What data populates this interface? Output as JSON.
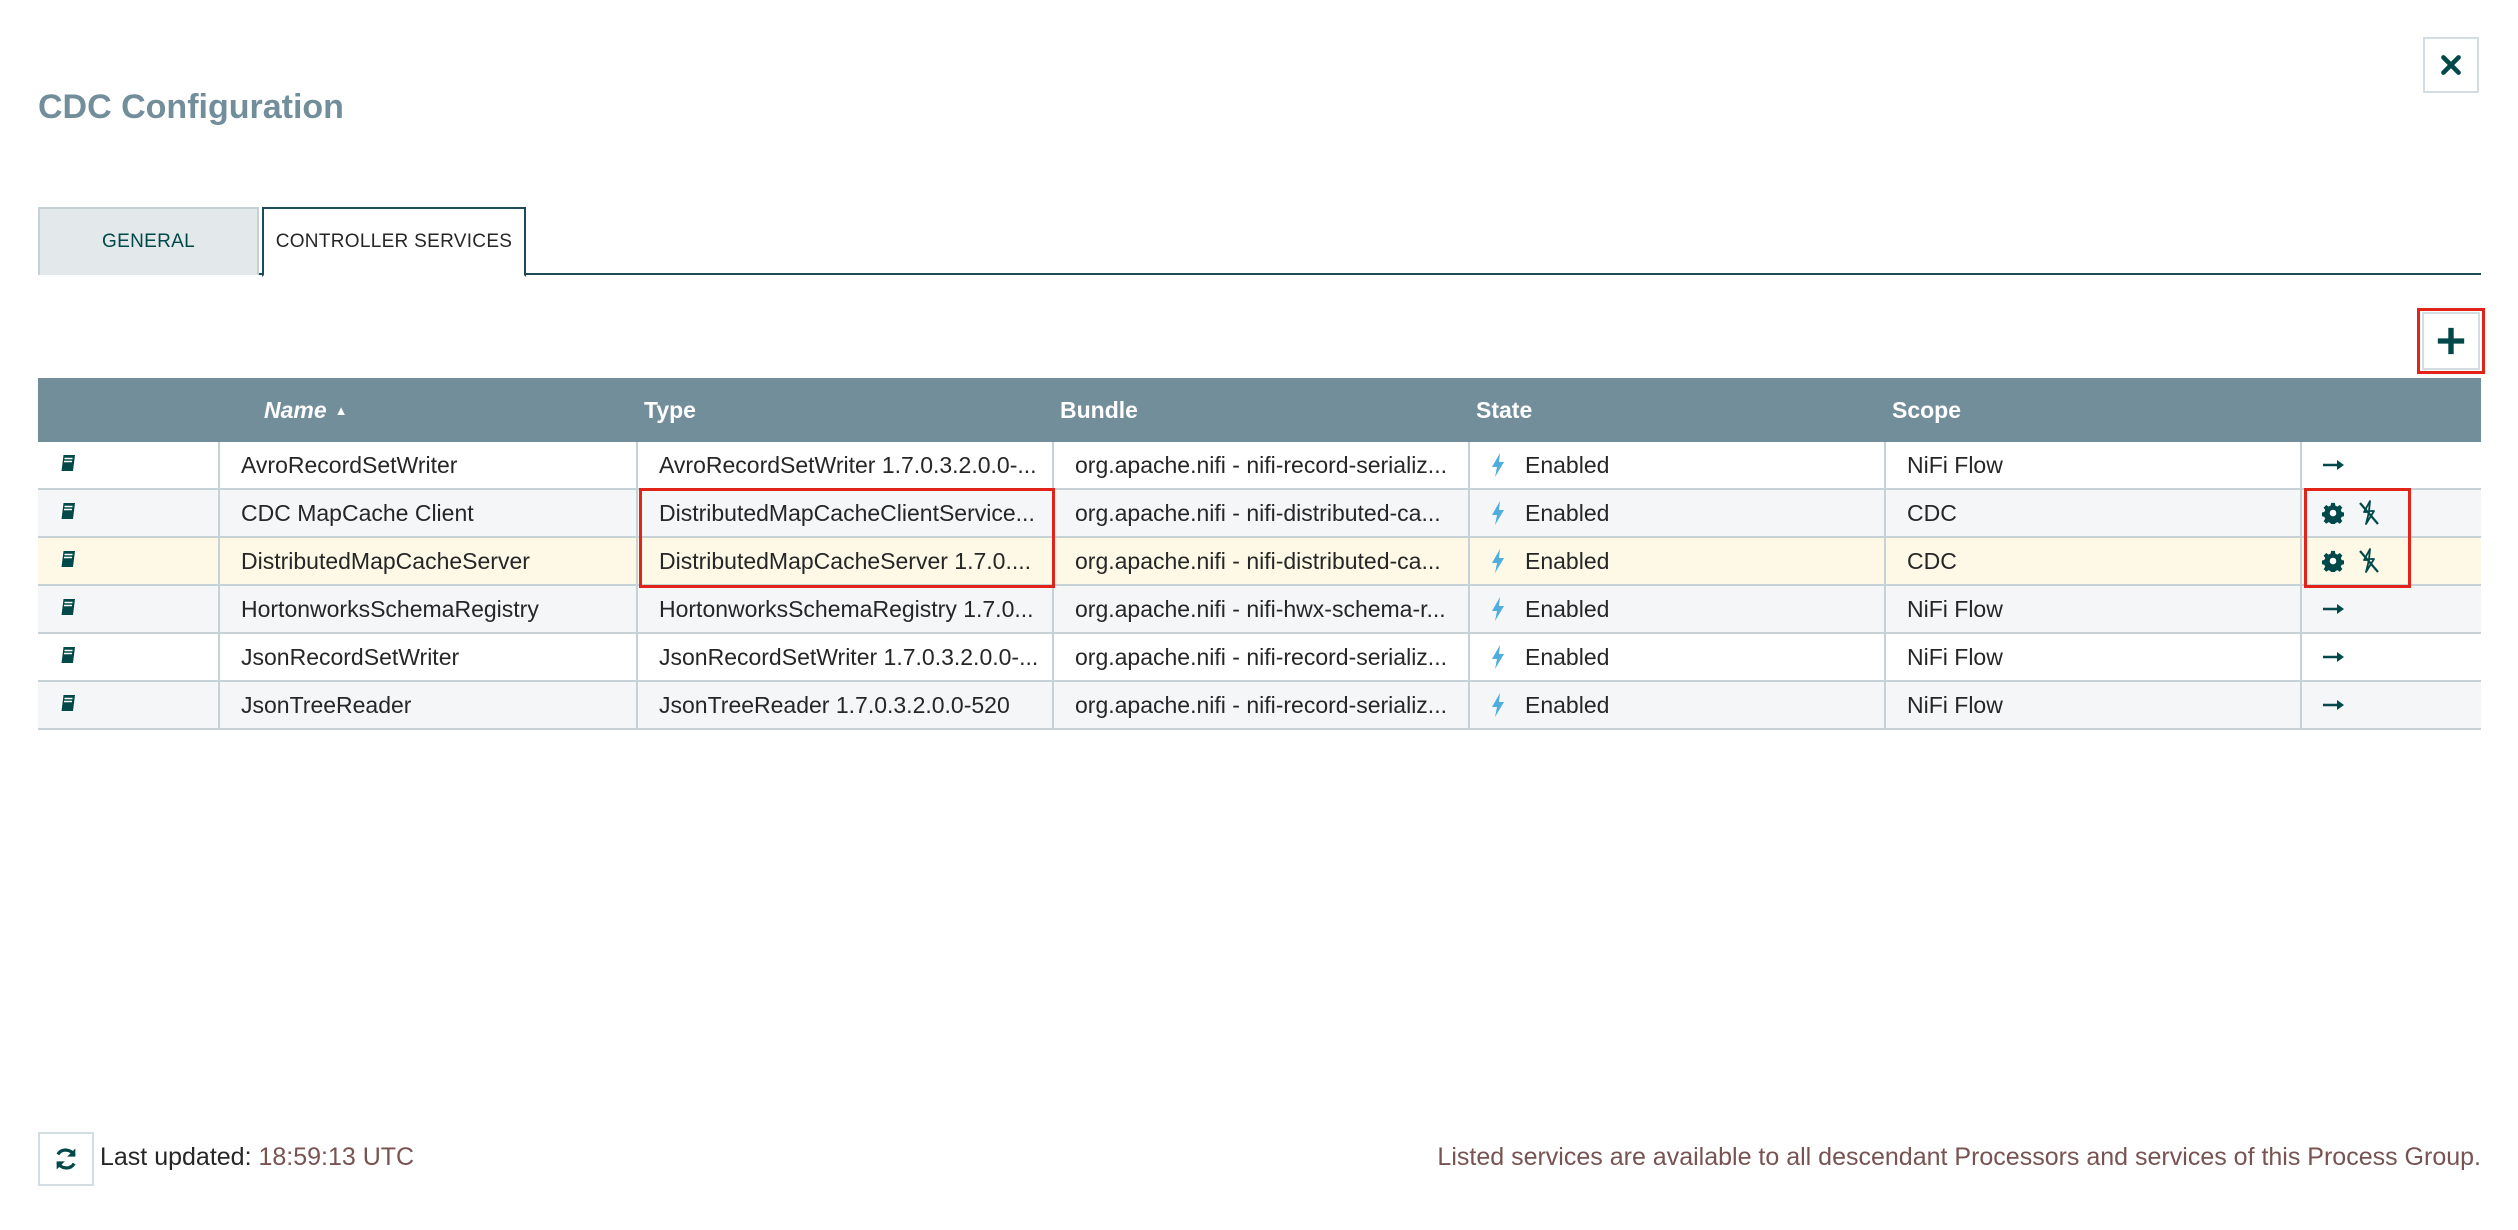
{
  "dialog": {
    "title": "CDC Configuration"
  },
  "tabs": [
    {
      "label": "GENERAL",
      "active": false
    },
    {
      "label": "CONTROLLER SERVICES",
      "active": true
    }
  ],
  "grid": {
    "headers": {
      "name": "Name",
      "type": "Type",
      "bundle": "Bundle",
      "state": "State",
      "scope": "Scope"
    },
    "sort": {
      "column": "Name",
      "direction": "ascending"
    },
    "rows": [
      {
        "name": "AvroRecordSetWriter",
        "type": "AvroRecordSetWriter 1.7.0.3.2.0.0-...",
        "bundle": "org.apache.nifi - nifi-record-serializ...",
        "state": "Enabled",
        "scope": "NiFi Flow",
        "actions": [
          "go-to-icon"
        ]
      },
      {
        "name": "CDC MapCache Client",
        "type": "DistributedMapCacheClientService...",
        "bundle": "org.apache.nifi - nifi-distributed-ca...",
        "state": "Enabled",
        "scope": "CDC",
        "actions": [
          "gear-icon",
          "disable-icon"
        ]
      },
      {
        "name": "DistributedMapCacheServer",
        "type": "DistributedMapCacheServer 1.7.0....",
        "bundle": "org.apache.nifi - nifi-distributed-ca...",
        "state": "Enabled",
        "scope": "CDC",
        "actions": [
          "gear-icon",
          "disable-icon"
        ]
      },
      {
        "name": "HortonworksSchemaRegistry",
        "type": "HortonworksSchemaRegistry 1.7.0...",
        "bundle": "org.apache.nifi - nifi-hwx-schema-r...",
        "state": "Enabled",
        "scope": "NiFi Flow",
        "actions": [
          "go-to-icon"
        ]
      },
      {
        "name": "JsonRecordSetWriter",
        "type": "JsonRecordSetWriter 1.7.0.3.2.0.0-...",
        "bundle": "org.apache.nifi - nifi-record-serializ...",
        "state": "Enabled",
        "scope": "NiFi Flow",
        "actions": [
          "go-to-icon"
        ]
      },
      {
        "name": "JsonTreeReader",
        "type": "JsonTreeReader 1.7.0.3.2.0.0-520",
        "bundle": "org.apache.nifi - nifi-record-serializ...",
        "state": "Enabled",
        "scope": "NiFi Flow",
        "actions": [
          "go-to-icon"
        ]
      }
    ]
  },
  "footer": {
    "last_updated_label": "Last updated:",
    "last_updated_time": "18:59:13 UTC",
    "note": "Listed services are available to all descendant Processors and services of this Process Group."
  },
  "colors": {
    "header_bg": "#728e9b",
    "title": "#728e9b",
    "accent_dark": "#004849",
    "bolt": "#4faedf",
    "highlight": "#e2231a",
    "footer_text": "#775351",
    "selected_row": "#fdf9e6"
  }
}
